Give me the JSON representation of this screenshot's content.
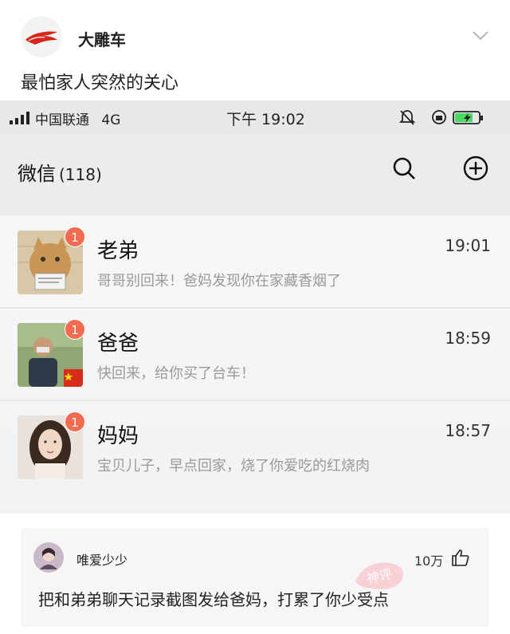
{
  "post": {
    "author": "大雕车",
    "text": "最怕家人突然的关心"
  },
  "status_bar": {
    "carrier": "中国联通",
    "network": "4G",
    "time": "下午 19:02"
  },
  "wechat": {
    "title": "微信",
    "unread_total": "(118)"
  },
  "chats": [
    {
      "name": "老弟",
      "time": "19:01",
      "badge": "1",
      "preview": "哥哥别回来！爸妈发现你在家藏香烟了"
    },
    {
      "name": "爸爸",
      "time": "18:59",
      "badge": "1",
      "preview": "快回来，给你买了台车！"
    },
    {
      "name": "妈妈",
      "time": "18:57",
      "badge": "1",
      "preview": "宝贝儿子，早点回家，烧了你爱吃的红烧肉"
    }
  ],
  "comment": {
    "user": "唯爱少少",
    "likes": "10万",
    "text": "把和弟弟聊天记录截图发给爸妈，打累了你少受点"
  },
  "colors": {
    "badge": "#f26a4f",
    "logo_red": "#d8261c",
    "preview_text": "#9a9a9a",
    "comment_bg": "#f6f6f6"
  }
}
